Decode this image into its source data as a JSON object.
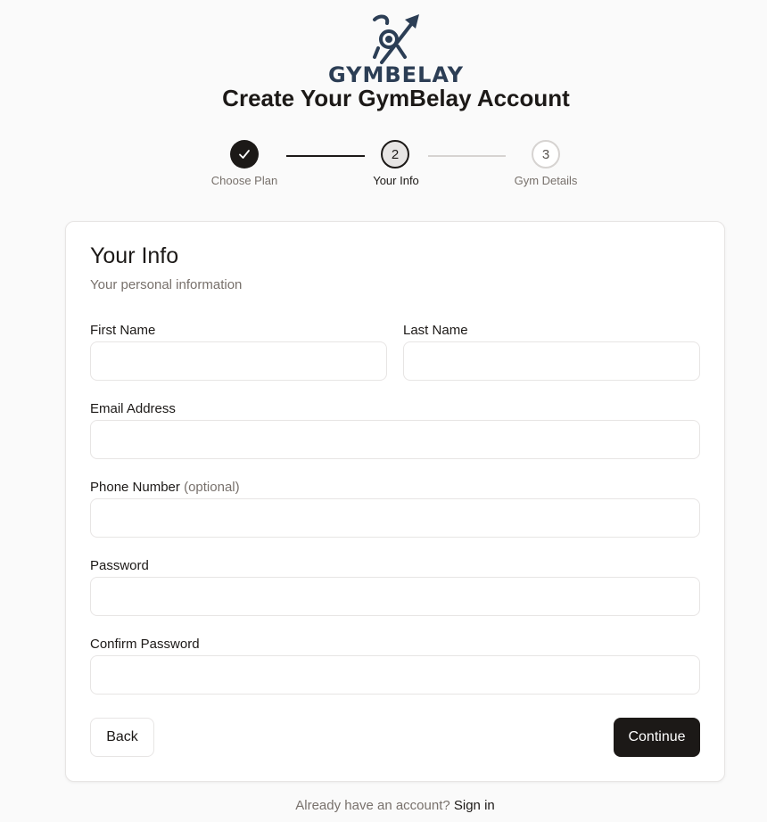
{
  "brand": {
    "name": "GYMBELAY",
    "logo_icon": "climber-arrow-icon",
    "color": "#2c3e55"
  },
  "page": {
    "title": "Create Your GymBelay Account"
  },
  "stepper": {
    "steps": [
      {
        "number": "1",
        "label": "Choose Plan",
        "status": "complete",
        "icon": "check-icon"
      },
      {
        "number": "2",
        "label": "Your Info",
        "status": "active"
      },
      {
        "number": "3",
        "label": "Gym Details",
        "status": "upcoming"
      }
    ]
  },
  "form": {
    "title": "Your Info",
    "subtitle": "Your personal information",
    "first_name": {
      "label": "First Name",
      "value": "",
      "placeholder": ""
    },
    "last_name": {
      "label": "Last Name",
      "value": "",
      "placeholder": ""
    },
    "email": {
      "label": "Email Address",
      "value": "",
      "placeholder": ""
    },
    "phone": {
      "label": "Phone Number",
      "hint": "(optional)",
      "value": "",
      "placeholder": ""
    },
    "password": {
      "label": "Password",
      "value": "",
      "placeholder": ""
    },
    "confirm_password": {
      "label": "Confirm Password",
      "value": "",
      "placeholder": ""
    },
    "back_label": "Back",
    "continue_label": "Continue"
  },
  "footer": {
    "prompt": "Already have an account?",
    "link_label": "Sign in"
  },
  "colors": {
    "primary": "#1c1917",
    "muted": "#78716c",
    "border": "#e7e5e4",
    "background": "#fafafa"
  }
}
